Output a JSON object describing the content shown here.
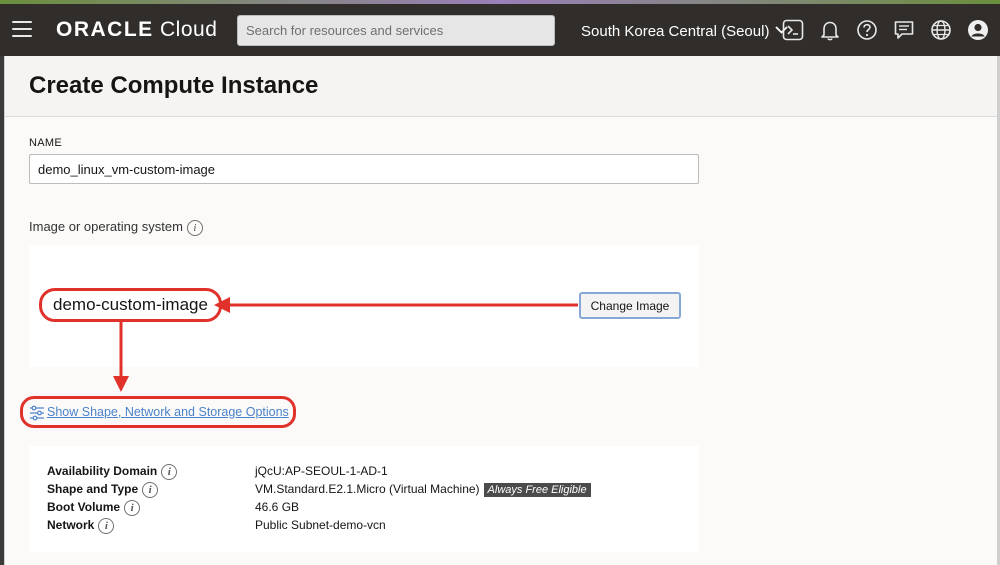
{
  "topbar": {
    "logo_brand": "ORACLE",
    "logo_product": "Cloud",
    "search_placeholder": "Search for resources and services",
    "region": "South Korea Central (Seoul)",
    "icons": [
      "menu-icon",
      "cloud-shell-icon",
      "bell-icon",
      "help-icon",
      "chat-icon",
      "globe-icon",
      "user-icon"
    ]
  },
  "page": {
    "title": "Create Compute Instance"
  },
  "form": {
    "name_label": "NAME",
    "name_value": "demo_linux_vm-custom-image",
    "image_label": "Image or operating system",
    "image_name": "demo-custom-image",
    "change_image_label": "Change Image",
    "show_options_label": "Show Shape, Network and Storage Options"
  },
  "details": [
    {
      "label": "Availability Domain",
      "value": "jQcU:AP-SEOUL-1-AD-1"
    },
    {
      "label": "Shape and Type",
      "value": "VM.Standard.E2.1.Micro (Virtual Machine)",
      "badge": "Always Free Eligible"
    },
    {
      "label": "Boot Volume",
      "value": "46.6 GB"
    },
    {
      "label": "Network",
      "value": "Public Subnet-demo-vcn"
    }
  ],
  "colors": {
    "topbar_bg": "#312d2a",
    "annotation_red": "#e0312a",
    "link_blue": "#4a82c9",
    "badge_bg": "#4b4b4b"
  }
}
